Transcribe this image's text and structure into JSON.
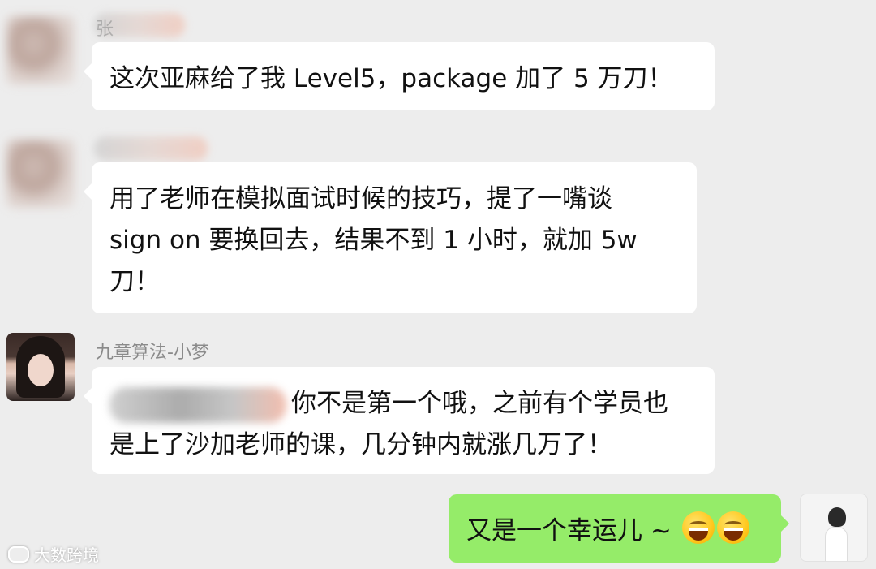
{
  "messages": [
    {
      "sender_visible": "张",
      "lines": [
        "这次亚麻给了我 Level5，package 加了 5 万刀！"
      ]
    },
    {
      "sender_visible": "",
      "lines": [
        "用了老师在模拟面试时候的技巧，提了一嘴谈",
        "sign on 要换回去，结果不到 1 小时，就加 5w",
        "刀！"
      ]
    },
    {
      "sender_visible": "九章算法-小梦",
      "lines": [
        "你不是第一个哦，之前有个学员也",
        "是上了沙加老师的课，几分钟内就涨几万了！"
      ]
    },
    {
      "sender_visible": "",
      "lines": [
        "又是一个幸运儿 ~ "
      ],
      "emoji": [
        "grinning-face-emoji",
        "grinning-face-emoji"
      ]
    }
  ],
  "watermark": {
    "text": "大数跨境"
  },
  "colors": {
    "background": "#ededed",
    "incoming_bubble": "#ffffff",
    "outgoing_bubble": "#95ec69",
    "name_text": "#8a8a8a"
  }
}
